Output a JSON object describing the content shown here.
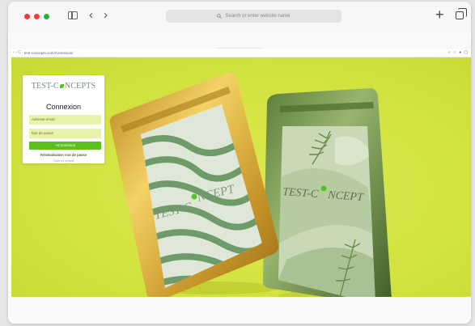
{
  "browser": {
    "address_text": "Search or enter website name",
    "back_icon": "‹",
    "forward_icon": "›",
    "new_tab_icon": "+"
  },
  "inner_browser": {
    "url": "test-concepts.com/Connexion/",
    "nav_icons": "‹ › C",
    "ext_icons": [
      "⌕",
      "☆",
      "●",
      "▢"
    ]
  },
  "login": {
    "logo_left": "TEST-C",
    "logo_right": "NCEPTS",
    "title": "Connexion",
    "email_placeholder": "Adresse email",
    "password_placeholder": "Mot de passe",
    "submit_label": "Connexion",
    "reset_link": "Réinitialisation mot de passe",
    "sub_link": "Créer un compte"
  },
  "bags": {
    "left_brand": "TEST-C",
    "left_brand_end": "NCEPT",
    "right_brand": "TEST-C",
    "right_brand_end": "NCEPT"
  },
  "colors": {
    "hero_bg": "#d2e23f",
    "accent_green": "#5bbf1c",
    "field_bg": "#e8f2a8"
  }
}
